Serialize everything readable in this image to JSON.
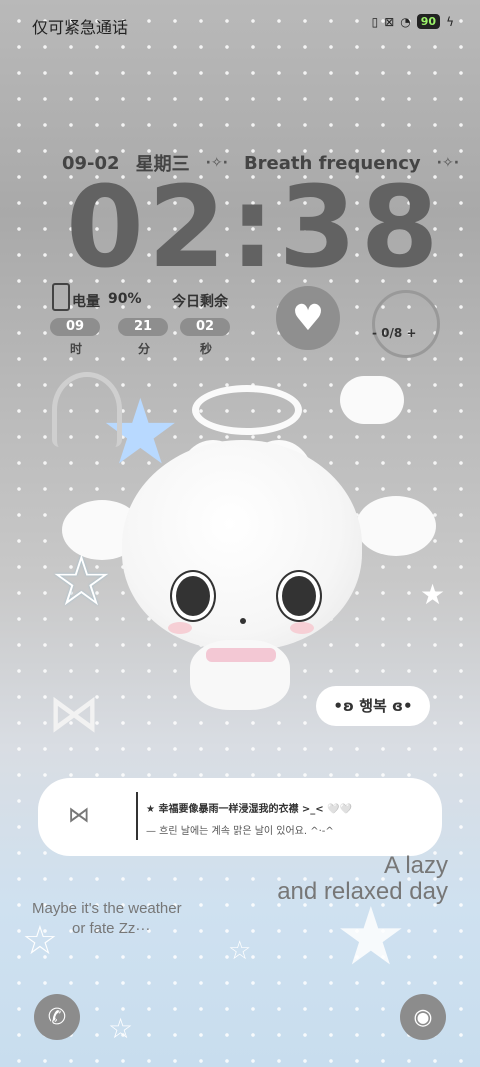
{
  "status": {
    "left_text": "仅可紧急通话",
    "battery": "90",
    "right_icons": [
      "vibrate-icon",
      "battery-saver-icon",
      "wifi-icon",
      "battery-icon",
      "charging-icon"
    ]
  },
  "header": {
    "date": "09-02",
    "weekday": "星期三",
    "breath": "Breath frequency",
    "sparkle_left": "·✧·",
    "sparkle_right": "·✧·"
  },
  "clock": {
    "time": "02:38"
  },
  "battery_info": {
    "label": "电量",
    "value": "90%",
    "today_remaining_label": "今日剩余",
    "hours": "09",
    "minutes": "21",
    "seconds": "02",
    "unit_h": "时",
    "unit_m": "分",
    "unit_s": "秒"
  },
  "widgets": {
    "water_count": "- 0/8 +"
  },
  "bubble": {
    "text": "•ʚ 행복 ɞ•"
  },
  "card": {
    "line1": "★ 幸福要像暴雨一样浸湿我的衣襟 >_< 🤍🤍",
    "line2": "— 흐린 날에는 계속 맑은 날이 있어요. ^·-^"
  },
  "captions": {
    "lazy1": "A lazy",
    "lazy2": "and relaxed day",
    "weather1": "Maybe it's the weather",
    "weather2": "or fate Zz···"
  },
  "bottom": {
    "left_icon": "phone-icon",
    "right_icon": "camera-icon"
  }
}
